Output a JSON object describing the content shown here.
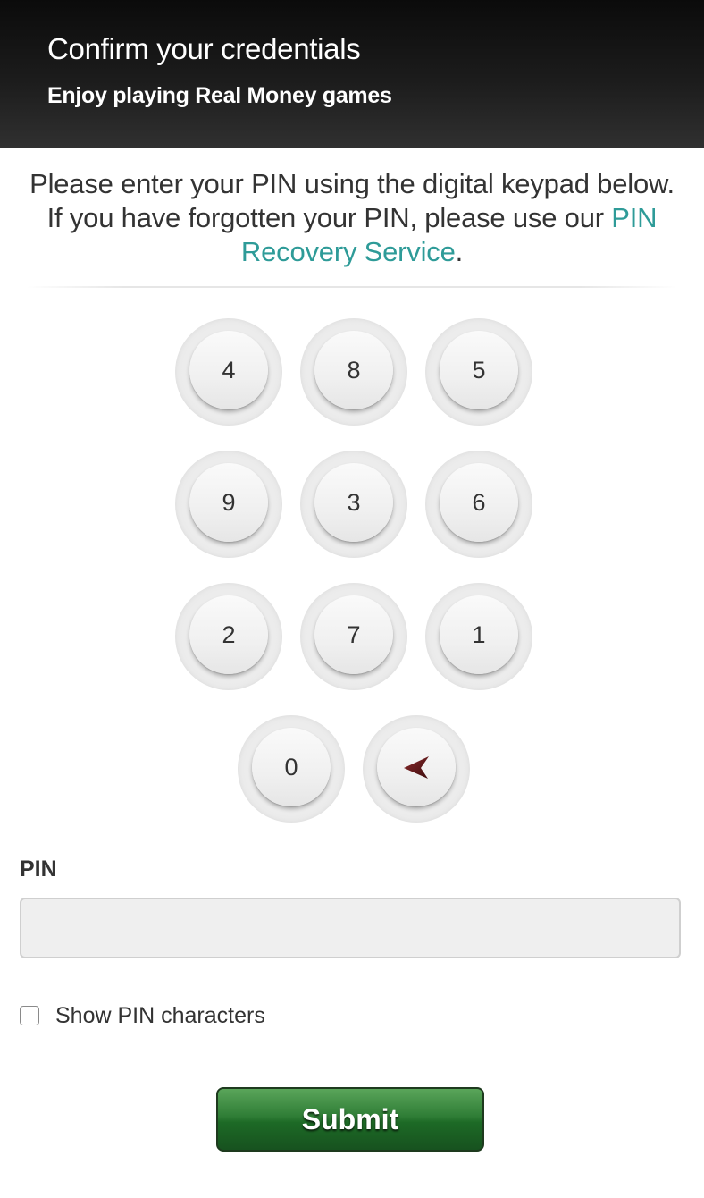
{
  "header": {
    "title": "Confirm your credentials",
    "subtitle": "Enjoy playing Real Money games"
  },
  "instructions": {
    "text_before": "Please enter your PIN using the digital keypad below. If you have forgotten your PIN, please use our ",
    "link_text": "PIN Recovery Service",
    "text_after": "."
  },
  "keypad": {
    "rows": [
      [
        "4",
        "8",
        "5"
      ],
      [
        "9",
        "3",
        "6"
      ],
      [
        "2",
        "7",
        "1"
      ],
      [
        "0"
      ]
    ],
    "backspace_icon": "backspace-arrow-icon"
  },
  "pin_field": {
    "label": "PIN",
    "value": "",
    "placeholder": ""
  },
  "show_pin": {
    "label": "Show PIN characters",
    "checked": false
  },
  "submit": {
    "label": "Submit"
  },
  "colors": {
    "link": "#2e9b98",
    "submit_green": "#2f7d36",
    "backspace_arrow": "#5a1416"
  }
}
